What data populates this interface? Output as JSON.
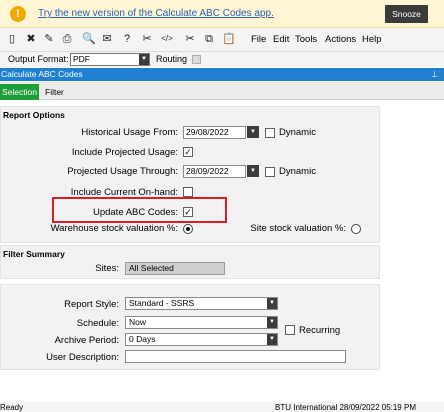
{
  "banner": {
    "icon": "!",
    "link_text": "Try the new version of the Calculate ABC Codes app.",
    "snooze_label": "Snooze"
  },
  "toolbar": {
    "tools": [
      {
        "icon": "new-document-icon",
        "glyph": "▯"
      },
      {
        "icon": "delete-icon",
        "glyph": "✖"
      },
      {
        "icon": "brush-icon",
        "glyph": "✎"
      },
      {
        "icon": "print-icon",
        "glyph": "⎙"
      },
      {
        "icon": "print-preview-icon",
        "glyph": "🔍"
      },
      {
        "icon": "send-icon",
        "glyph": "✉"
      },
      {
        "icon": "query-icon",
        "glyph": "?"
      },
      {
        "icon": "filter-icon",
        "glyph": "✂"
      },
      {
        "icon": "code-icon",
        "glyph": "</>"
      },
      {
        "icon": "cut-icon",
        "glyph": "✂"
      },
      {
        "icon": "copy-icon",
        "glyph": "⧉"
      },
      {
        "icon": "paste-icon",
        "glyph": "📋"
      }
    ],
    "menus": [
      "File",
      "Edit",
      "Tools",
      "Actions",
      "Help"
    ]
  },
  "format": {
    "label": "Output Format:",
    "value": "PDF",
    "routing_label": "Routing"
  },
  "window": {
    "title": "Calculate ABC Codes",
    "pin": "⊥"
  },
  "tabs": {
    "selected": "Selection",
    "other": "Filter"
  },
  "report_options": {
    "title": "Report Options",
    "historical_label": "Historical Usage From:",
    "historical_value": "29/08/2022",
    "historical_dynamic": "Dynamic",
    "include_projected_label": "Include Projected Usage:",
    "include_projected_check": "✓",
    "projected_through_label": "Projected Usage Through:",
    "projected_through_value": "28/09/2022",
    "projected_dynamic": "Dynamic",
    "include_onhand_label": "Include Current On-hand:",
    "update_abc_label": "Update ABC Codes:",
    "update_abc_check": "✓",
    "warehouse_label": "Warehouse stock valuation %:",
    "site_label": "Site stock valuation %:"
  },
  "filter_summary": {
    "title": "Filter Summary",
    "sites_label": "Sites:",
    "sites_value": "All Selected"
  },
  "report_settings": {
    "style_label": "Report Style:",
    "style_value": "Standard - SSRS",
    "schedule_label": "Schedule:",
    "schedule_value": "Now",
    "recurring_label": "Recurring",
    "archive_label": "Archive Period:",
    "archive_value": "0 Days",
    "description_label": "User Description:",
    "description_value": ""
  },
  "status": {
    "left": "Ready",
    "right": "BTU International  28/09/2022   05:19 PM"
  }
}
